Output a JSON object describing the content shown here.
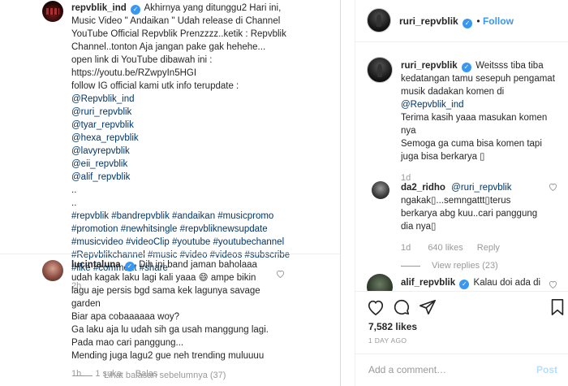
{
  "post": {
    "author": "repvblik_ind",
    "caption_lines": [
      "Akhirnya yang ditunggu2 Hari ini,",
      "Music Video \" Andaikan \" Udah release di Channel",
      "YouTube Official Repvblik Prenzzzz..ketik : Repvblik",
      "Channel..tonton Aja jangan pake gak hehehe...",
      "open link di YouTube dibawah ini :",
      "https://youtu.be/RZwpyIn5HGI",
      "follow IG official kami utk info terupdate :"
    ],
    "mentions": [
      "@Repvblik_ind",
      "@ruri_repvblik",
      "@tyar_repvblik",
      "@hexa_repvblik",
      "@lavyrepvblik",
      "@eii_repvblik",
      "@alif_repvblik"
    ],
    "dots": [
      "..",
      ".."
    ],
    "hashtag_lines": [
      "#repvblik #bandrepvblik #andaikan #musicpromo",
      "#promotion #newhitsingle #repvbliknewsupdate",
      "#musicvideo #videoClip #youtube #youtubechannel",
      "#Repvblikchannel #music #video #videos #subscribe",
      "#like #comment #share"
    ],
    "age": "2h"
  },
  "comment_luna": {
    "author": "lucintaluna",
    "lines": [
      "Dih ini band jaman baholaaa",
      "udah kagak laku lagi kali yaaa 😄 ampe bikin",
      "lagu aje persis bgd sama kek lagunya savage",
      "garden",
      "Biar apa cobaaaaaa woy?",
      "Ga laku aja lu udah sih ga usah manggung lagi.",
      "Pada mao cari panggung...",
      "Mending juga lagu2 gue neh trending muluuuu"
    ],
    "age": "1h",
    "likes": "1 suka",
    "reply": "Balas",
    "view_previous": "Lihat balasan sebelumnya (37)"
  },
  "right": {
    "header_user": "ruri_repvblik",
    "follow_label": "Follow",
    "reply1": {
      "author": "ruri_repvblik",
      "lines": [
        "Weitsss tiba tiba",
        "kedatangan tamu sesepuh pengamat",
        "musik dadakan komen di",
        "@Repvblik_ind",
        "Terima kasih yaaa masukan komen",
        "nya",
        "Semoga ga cuma bisa komen tapi",
        "juga bisa berkarya ▯"
      ],
      "age": "1d"
    },
    "reply2": {
      "author": "da2_ridho",
      "mention": "@ruri_repvblik",
      "lines": [
        "ngakak▯...semngattt▯terus",
        "berkarya abg kuu..cari panggung",
        "dia nya▯"
      ],
      "age": "1d",
      "likes": "640 likes",
      "reply": "Reply",
      "view_replies": "View replies (23)"
    },
    "reply3": {
      "author": "alif_repvblik",
      "text": "Kalau doi ada di"
    },
    "likes_count": "7,582 likes",
    "date": "1 DAY AGO",
    "add_comment_placeholder": "Add a comment…",
    "post_label": "Post"
  },
  "icons": [
    "more-icon",
    "heart-icon",
    "comment-icon",
    "share-icon",
    "bookmark-icon",
    "verified-icon"
  ]
}
